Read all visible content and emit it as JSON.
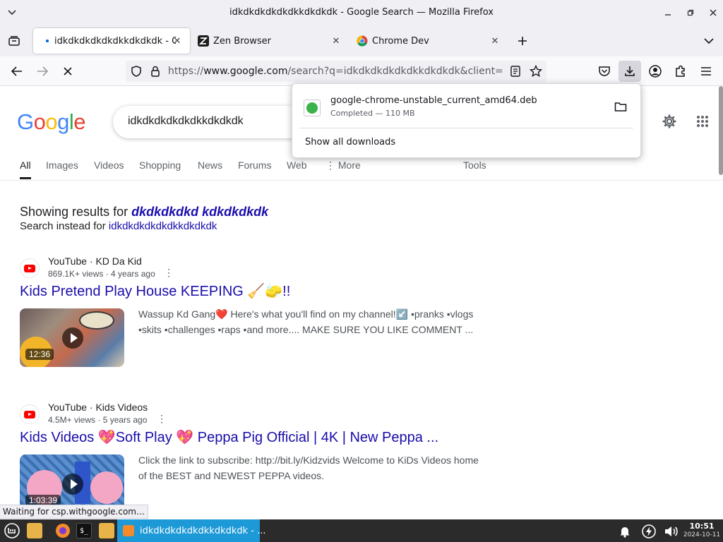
{
  "window": {
    "title": "idkdkdkdkdkdkkdkdkdk - Google Search — Mozilla Firefox"
  },
  "tabs": [
    {
      "label": "idkdkdkdkdkdkkdkdkdk - Go",
      "active": true
    },
    {
      "label": "Zen Browser",
      "active": false
    },
    {
      "label": "Chrome Dev",
      "active": false
    }
  ],
  "urlbar": {
    "scheme": "https://",
    "host": "www.google.com",
    "rest": "/search?q=idkdkdkdkdkdkkdkdkdk&client=firefox-b-"
  },
  "downloads": {
    "filename": "google-chrome-unstable_current_amd64.deb",
    "status": "Completed — 110 MB",
    "show_all": "Show all downloads"
  },
  "google": {
    "query": "idkdkdkdkdkdkkdkdkdk",
    "tabs": [
      "All",
      "Images",
      "Videos",
      "Shopping",
      "News",
      "Forums",
      "Web",
      "More",
      "Tools"
    ],
    "showing_prefix": "Showing results for ",
    "showing_query": "dkdkdkdkd kdkdkdkdk",
    "instead_prefix": "Search instead for ",
    "instead_query": "idkdkdkdkdkdkkdkdkdk"
  },
  "results": [
    {
      "source": "YouTube · KD Da Kid",
      "meta": "869.1K+ views · 4 years ago",
      "title": "Kids Pretend Play House KEEPING 🧹🧽!!",
      "duration": "12:36",
      "snippet_line1": "Wassup Kd Gang❤️ Here's what you'll find on my channel!↙️ •pranks •vlogs",
      "snippet_line2": "•skits •challenges •raps •and more.... MAKE SURE YOU LIKE COMMENT ..."
    },
    {
      "source": "YouTube · Kids Videos",
      "meta": "4.5M+ views · 5 years ago",
      "title": "Kids Videos 💖Soft Play 💖 Peppa Pig Official | 4K | New Peppa ...",
      "duration": "1:03:39",
      "snippet_line1": "Click the link to subscribe: http://bit.ly/Kidzvids Welcome to KiDs Videos home",
      "snippet_line2": "of the BEST and NEWEST PEPPA videos."
    }
  ],
  "status": "Waiting for csp.withgoogle.com…",
  "taskbar": {
    "window_label": "idkdkdkdkdkdkkdkdkdk - ...",
    "time": "10:51",
    "date": "2024-10-11"
  },
  "colors": {
    "taskbar_active": "#1c99d6",
    "link": "#1a0dab"
  }
}
